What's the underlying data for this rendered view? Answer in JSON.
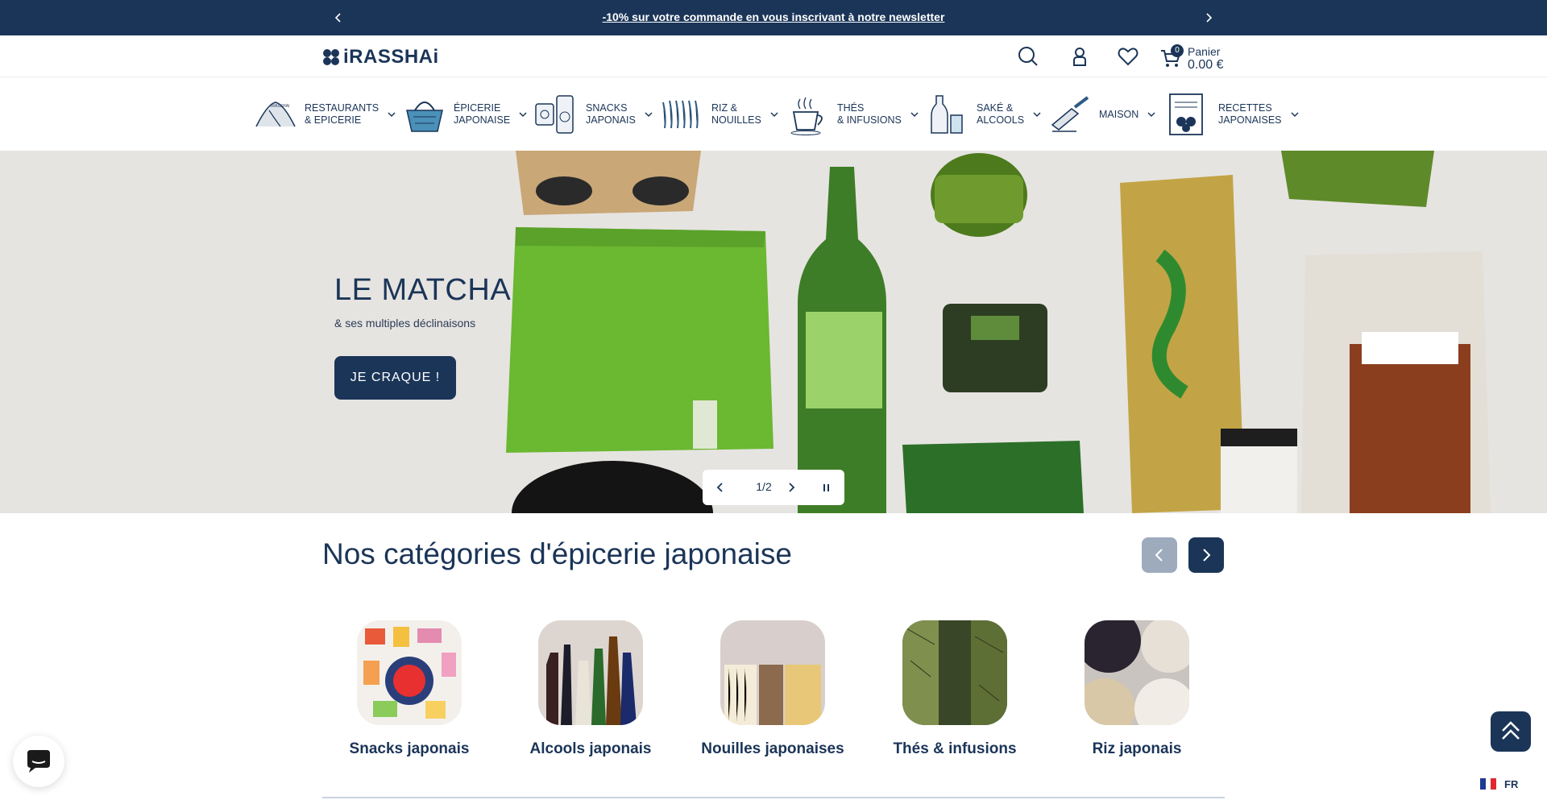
{
  "announcement": {
    "text": "-10% sur votre commande en vous inscrivant à notre newsletter"
  },
  "header": {
    "logo_text": "iRASSHAi",
    "cart": {
      "count": "0",
      "label": "Panier",
      "amount": "0.00 €"
    }
  },
  "nav": {
    "items": [
      {
        "label": "RESTAURANTS\n& EPICERIE",
        "icon": "restaurant-icon"
      },
      {
        "label": "ÉPICERIE\nJAPONAISE",
        "icon": "basket-icon"
      },
      {
        "label": "SNACKS\nJAPONAIS",
        "icon": "snacks-icon"
      },
      {
        "label": "RIZ &\nNOUILLES",
        "icon": "noodles-icon"
      },
      {
        "label": "THÉS\n& INFUSIONS",
        "icon": "tea-cup-icon"
      },
      {
        "label": "SAKÉ &\nALCOOLS",
        "icon": "sake-bottle-icon"
      },
      {
        "label": "MAISON",
        "icon": "knife-icon"
      },
      {
        "label": "RECETTES\nJAPONAISES",
        "icon": "recipe-icon"
      }
    ]
  },
  "hero": {
    "title": "LE MATCHA",
    "subtitle": "& ses multiples déclinaisons",
    "button": "JE CRAQUE !",
    "slide_counter": "1/2"
  },
  "categories": {
    "title": "Nos catégories d'épicerie japonaise",
    "items": [
      {
        "name": "Snacks japonais"
      },
      {
        "name": "Alcools japonais"
      },
      {
        "name": "Nouilles japonaises"
      },
      {
        "name": "Thés & infusions"
      },
      {
        "name": "Riz japonais"
      }
    ]
  },
  "language": {
    "code": "FR"
  },
  "colors": {
    "brand": "#1b3558",
    "accent_light": "#9eabbd"
  }
}
